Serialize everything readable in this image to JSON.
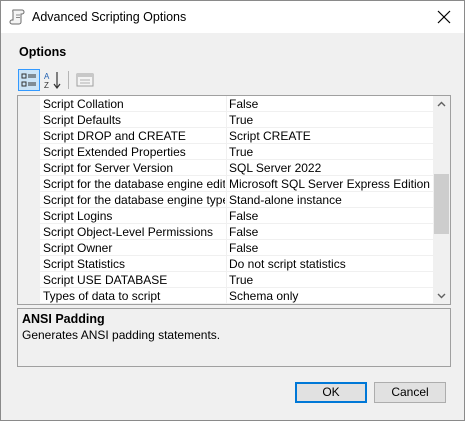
{
  "window": {
    "title": "Advanced Scripting Options"
  },
  "options_label": "Options",
  "icons": {
    "title": "script-icon",
    "close": "close-icon",
    "categorized": "categorized-icon",
    "alphabetical": "sort-alphabetical-icon",
    "property_pages": "property-pages-icon",
    "scroll_up": "chevron-up-icon",
    "scroll_down": "chevron-down-icon"
  },
  "properties": [
    {
      "name": "Script Collation",
      "value": "False"
    },
    {
      "name": "Script Defaults",
      "value": "True"
    },
    {
      "name": "Script DROP and CREATE",
      "value": "Script CREATE"
    },
    {
      "name": "Script Extended Properties",
      "value": "True"
    },
    {
      "name": "Script for Server Version",
      "value": "SQL Server 2022"
    },
    {
      "name": "Script for the database engine edition",
      "value": "Microsoft SQL Server Express Edition"
    },
    {
      "name": "Script for the database engine type",
      "value": "Stand-alone instance"
    },
    {
      "name": "Script Logins",
      "value": "False"
    },
    {
      "name": "Script Object-Level Permissions",
      "value": "False"
    },
    {
      "name": "Script Owner",
      "value": "False"
    },
    {
      "name": "Script Statistics",
      "value": "Do not script statistics"
    },
    {
      "name": "Script USE DATABASE",
      "value": "True"
    },
    {
      "name": "Types of data to script",
      "value": "Schema only"
    }
  ],
  "description": {
    "title": "ANSI Padding",
    "text": "Generates ANSI padding statements."
  },
  "buttons": {
    "ok": "OK",
    "cancel": "Cancel"
  },
  "colors": {
    "accent": "#0078d7",
    "selected_tool": "#cce4f7"
  }
}
